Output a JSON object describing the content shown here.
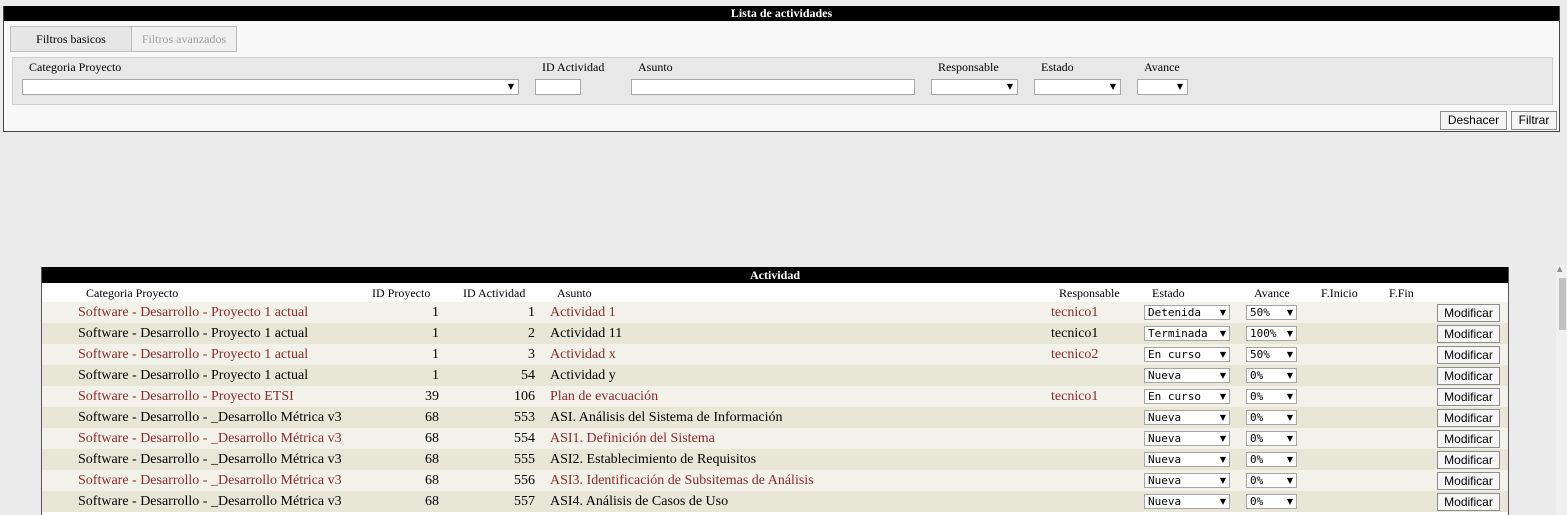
{
  "filter_panel": {
    "title": "Lista de actividades",
    "tabs": {
      "basic": "Filtros basicos",
      "advanced": "Filtros avanzados"
    },
    "labels": {
      "categoria": "Categoria Proyecto",
      "id_actividad": "ID Actividad",
      "asunto": "Asunto",
      "responsable": "Responsable",
      "estado": "Estado",
      "avance": "Avance"
    },
    "buttons": {
      "undo": "Deshacer",
      "filter": "Filtrar"
    }
  },
  "table": {
    "title": "Actividad",
    "headers": {
      "categoria": "Categoria Proyecto",
      "id_proyecto": "ID Proyecto",
      "id_actividad": "ID Actividad",
      "asunto": "Asunto",
      "responsable": "Responsable",
      "estado": "Estado",
      "avance": "Avance",
      "finicio": "F.Inicio",
      "ffin": "F.Fin"
    },
    "modify_label": "Modificar",
    "rows": [
      {
        "categoria": "Software - Desarrollo - Proyecto 1 actual",
        "id_proyecto": "1",
        "id_actividad": "1",
        "asunto": "Actividad 1",
        "responsable": "tecnico1",
        "estado": "Detenida",
        "avance": "50%"
      },
      {
        "categoria": "Software - Desarrollo - Proyecto 1 actual",
        "id_proyecto": "1",
        "id_actividad": "2",
        "asunto": "Actividad 11",
        "responsable": "tecnico1",
        "estado": "Terminada",
        "avance": "100%"
      },
      {
        "categoria": "Software - Desarrollo - Proyecto 1 actual",
        "id_proyecto": "1",
        "id_actividad": "3",
        "asunto": "Actividad x",
        "responsable": "tecnico2",
        "estado": "En curso",
        "avance": "50%"
      },
      {
        "categoria": "Software - Desarrollo - Proyecto 1 actual",
        "id_proyecto": "1",
        "id_actividad": "54",
        "asunto": "Actividad y",
        "responsable": "",
        "estado": "Nueva",
        "avance": "0%"
      },
      {
        "categoria": "Software - Desarrollo - Proyecto ETSI",
        "id_proyecto": "39",
        "id_actividad": "106",
        "asunto": "Plan de evacuación",
        "responsable": "tecnico1",
        "estado": "En curso",
        "avance": "0%"
      },
      {
        "categoria": "Software - Desarrollo - _Desarrollo Métrica v3",
        "id_proyecto": "68",
        "id_actividad": "553",
        "asunto": "ASI. Análisis del Sistema de Información",
        "responsable": "",
        "estado": "Nueva",
        "avance": "0%"
      },
      {
        "categoria": "Software - Desarrollo - _Desarrollo Métrica v3",
        "id_proyecto": "68",
        "id_actividad": "554",
        "asunto": "ASI1. Definición del Sistema",
        "responsable": "",
        "estado": "Nueva",
        "avance": "0%"
      },
      {
        "categoria": "Software - Desarrollo - _Desarrollo Métrica v3",
        "id_proyecto": "68",
        "id_actividad": "555",
        "asunto": "ASI2. Establecimiento de Requisitos",
        "responsable": "",
        "estado": "Nueva",
        "avance": "0%"
      },
      {
        "categoria": "Software - Desarrollo - _Desarrollo Métrica v3",
        "id_proyecto": "68",
        "id_actividad": "556",
        "asunto": "ASI3. Identificación de Subsitemas de Análisis",
        "responsable": "",
        "estado": "Nueva",
        "avance": "0%"
      },
      {
        "categoria": "Software - Desarrollo - _Desarrollo Métrica v3",
        "id_proyecto": "68",
        "id_actividad": "557",
        "asunto": "ASI4. Análisis de Casos de Uso",
        "responsable": "",
        "estado": "Nueva",
        "avance": "0%"
      }
    ]
  }
}
